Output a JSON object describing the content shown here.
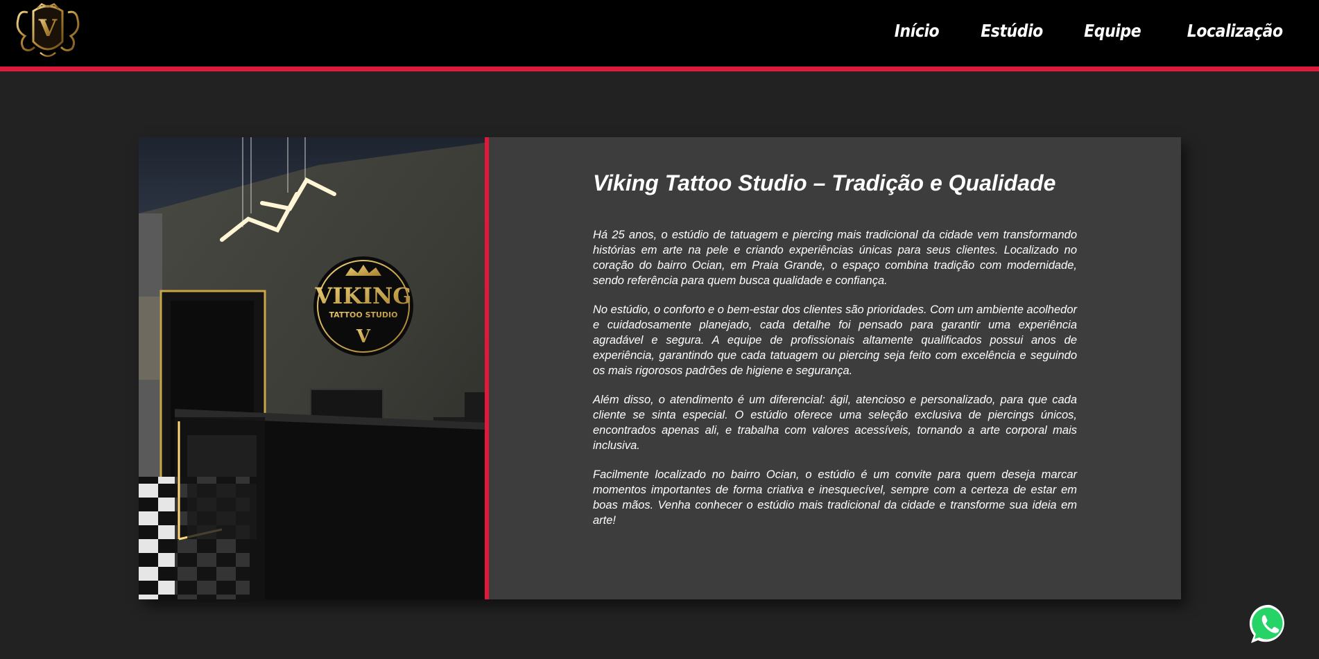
{
  "nav": {
    "items": [
      {
        "label": "Início"
      },
      {
        "label": "Estúdio"
      },
      {
        "label": "Equipe"
      },
      {
        "label": "Localização"
      }
    ]
  },
  "logo": {
    "icon": "studio-crest-logo",
    "letter": "V"
  },
  "photo": {
    "sign_line1": "VIKING",
    "sign_line2": "TATTOO STUDIO",
    "sign_letter": "V"
  },
  "about": {
    "title": "Viking Tattoo Studio – Tradição e Qualidade",
    "paragraphs": [
      "Há 25 anos, o estúdio de tatuagem e piercing mais tradicional da cidade vem transformando histórias em arte na pele e criando experiências únicas para seus clientes. Localizado no coração do bairro Ocian, em Praia Grande, o espaço combina tradição com modernidade, sendo referência para quem busca qualidade e confiança.",
      "No estúdio, o conforto e o bem-estar dos clientes são prioridades. Com um ambiente acolhedor e cuidadosamente planejado, cada detalhe foi pensado para garantir uma experiência agradável e segura. A equipe de profissionais altamente qualificados possui anos de experiência, garantindo que cada tatuagem ou piercing seja feito com excelência e seguindo os mais rigorosos padrões de higiene e segurança.",
      "Além disso, o atendimento é um diferencial: ágil, atencioso e personalizado, para que cada cliente se sinta especial. O estúdio oferece uma seleção exclusiva de piercings únicos, encontrados apenas ali, e trabalha com valores acessíveis, tornando a arte corporal mais inclusiva.",
      "Facilmente localizado no bairro Ocian, o estúdio é um convite para quem deseja marcar momentos importantes de forma criativa e inesquecível, sempre com a certeza de estar em boas mãos. Venha conhecer o estúdio mais tradicional da cidade e transforme sua ideia em arte!"
    ]
  },
  "colors": {
    "accent": "#e0193a",
    "header_bg": "#000000",
    "page_bg": "#222222",
    "card_bg": "#3d3d3d",
    "gold": "#c9a646",
    "whatsapp": "#25d366"
  },
  "whatsapp": {
    "icon": "whatsapp-icon"
  }
}
